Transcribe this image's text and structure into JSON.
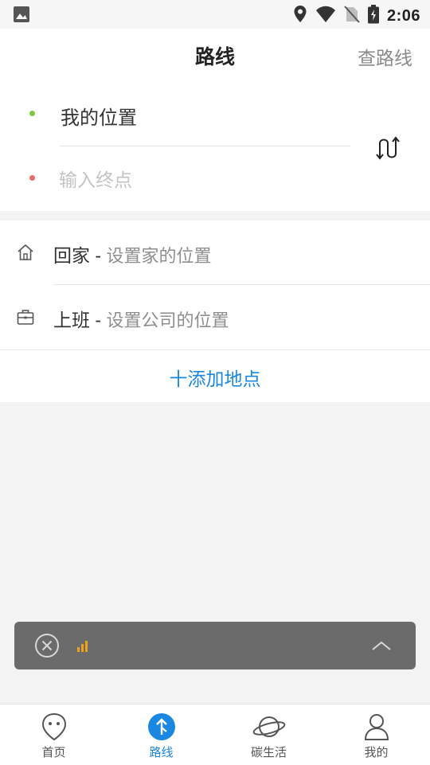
{
  "status_bar": {
    "time": "2:06",
    "icons": [
      "image-icon",
      "location-icon",
      "wifi-icon",
      "no-sim-icon",
      "battery-charging-icon"
    ]
  },
  "header": {
    "title": "路线",
    "right_link": "查路线"
  },
  "route": {
    "from": "我的位置",
    "to_placeholder": "输入终点",
    "swap_icon": "swap-route-icon"
  },
  "places": {
    "home": {
      "label": "回家",
      "separator": " - ",
      "hint": "设置家的位置",
      "icon": "home-icon"
    },
    "work": {
      "label": "上班",
      "separator": " - ",
      "hint": "设置公司的位置",
      "icon": "briefcase-icon"
    },
    "add_label": "十添加地点"
  },
  "floating_bar": {
    "close_icon": "close-circle-icon",
    "signal_icon": "signal-bars-icon",
    "expand_icon": "chevron-up-icon"
  },
  "tabs": [
    {
      "label": "首页",
      "icon": "home-face-icon",
      "active": false
    },
    {
      "label": "路线",
      "icon": "route-icon",
      "active": true
    },
    {
      "label": "碳生活",
      "icon": "planet-icon",
      "active": false
    },
    {
      "label": "我的",
      "icon": "user-icon",
      "active": false
    }
  ],
  "colors": {
    "accent": "#1a87e0",
    "start_dot": "#7ac943",
    "end_dot": "#ec6a6a",
    "signal": "#f0a21c",
    "float_bar_bg": "#6b6b6b"
  }
}
